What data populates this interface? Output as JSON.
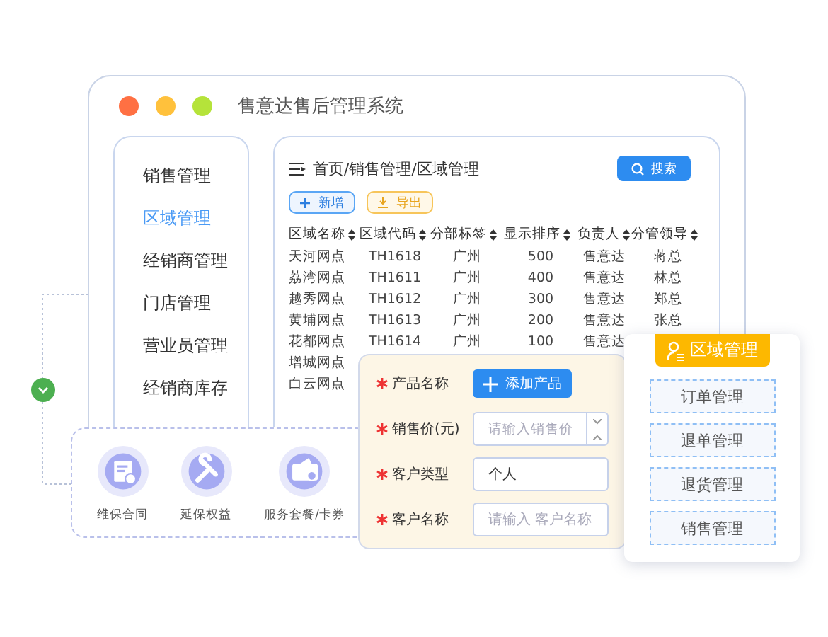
{
  "window": {
    "title": "售意达售后管理系统"
  },
  "sidebar": {
    "items": [
      {
        "label": "销售管理",
        "selected": false
      },
      {
        "label": "区域管理",
        "selected": true
      },
      {
        "label": "经销商管理",
        "selected": false
      },
      {
        "label": "门店管理",
        "selected": false
      },
      {
        "label": "营业员管理",
        "selected": false
      },
      {
        "label": "经销商库存",
        "selected": false
      }
    ]
  },
  "content": {
    "breadcrumb": "首页/销售管理/区域管理",
    "search_button": "搜索",
    "actions": [
      {
        "label": "新增",
        "kind": "add"
      },
      {
        "label": "导出",
        "kind": "export"
      }
    ],
    "table": {
      "columns": [
        "区域名称",
        "区域代码",
        "分部标签",
        "显示排序",
        "负责人",
        "分管领导"
      ],
      "rows": [
        [
          "天河网点",
          "TH1618",
          "广州",
          "500",
          "售意达",
          "蒋总"
        ],
        [
          "荔湾网点",
          "TH1611",
          "广州",
          "400",
          "售意达",
          "林总"
        ],
        [
          "越秀网点",
          "TH1612",
          "广州",
          "300",
          "售意达",
          "郑总"
        ],
        [
          "黄埔网点",
          "TH1613",
          "广州",
          "200",
          "售意达",
          "张总"
        ],
        [
          "花都网点",
          "TH1614",
          "广州",
          "100",
          "售意达"
        ],
        [
          "增城网点"
        ],
        [
          "白云网点"
        ]
      ]
    }
  },
  "services": [
    {
      "label": "维保合同",
      "kind": "contract"
    },
    {
      "label": "延保权益",
      "kind": "tools"
    },
    {
      "label": "服务套餐/卡券",
      "kind": "ticket"
    }
  ],
  "form": {
    "fields": [
      {
        "label": "产品名称",
        "required": true,
        "kind": "button",
        "value": "添加产品"
      },
      {
        "label": "销售价(元)",
        "required": true,
        "kind": "number",
        "placeholder": "请输入销售价"
      },
      {
        "label": "客户类型",
        "required": true,
        "kind": "text",
        "value": "个人"
      },
      {
        "label": "客户名称",
        "required": true,
        "kind": "text",
        "placeholder": "请输入 客户名称"
      }
    ]
  },
  "role_card": {
    "title": "区域管理",
    "items": [
      "订单管理",
      "退单管理",
      "退货管理",
      "销售管理"
    ]
  }
}
